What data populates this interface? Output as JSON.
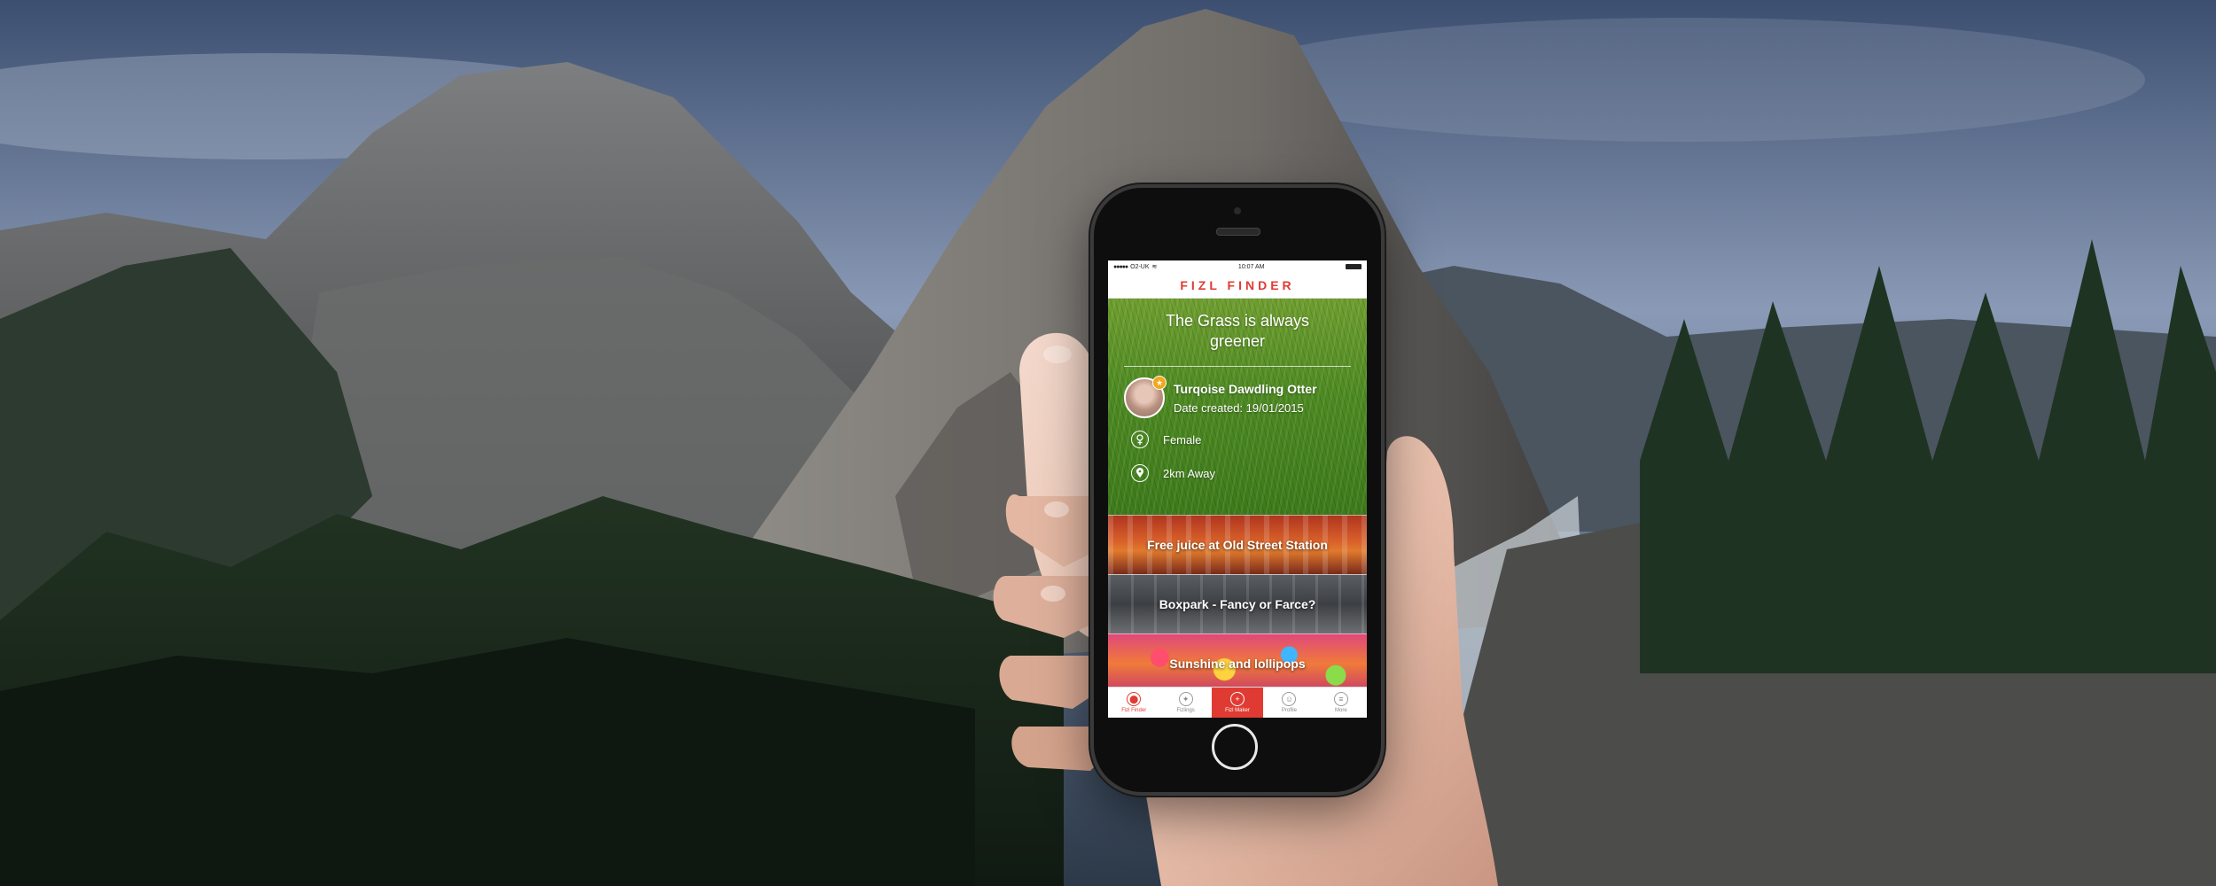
{
  "app": {
    "title": "FIZL FINDER",
    "accent_color": "#e03b33"
  },
  "status_bar": {
    "carrier": "O2-UK",
    "time": "10:07 AM"
  },
  "card": {
    "headline": "The Grass is always greener",
    "profile_name": "Turqoise Dawdling Otter",
    "date_created": "Date created: 19/01/2015",
    "gender": "Female",
    "distance": "2km Away"
  },
  "feed": [
    {
      "label": "Free juice at Old Street Station"
    },
    {
      "label": "Boxpark - Fancy or Farce?"
    },
    {
      "label": "Sunshine and lollipops"
    }
  ],
  "tabs": [
    {
      "label": "Fizl Finder",
      "icon": "map-pin-icon"
    },
    {
      "label": "Fizlings",
      "icon": "compass-icon"
    },
    {
      "label": "Fizl Maker",
      "icon": "plus-icon"
    },
    {
      "label": "Profile",
      "icon": "user-icon"
    },
    {
      "label": "More",
      "icon": "menu-icon"
    }
  ]
}
